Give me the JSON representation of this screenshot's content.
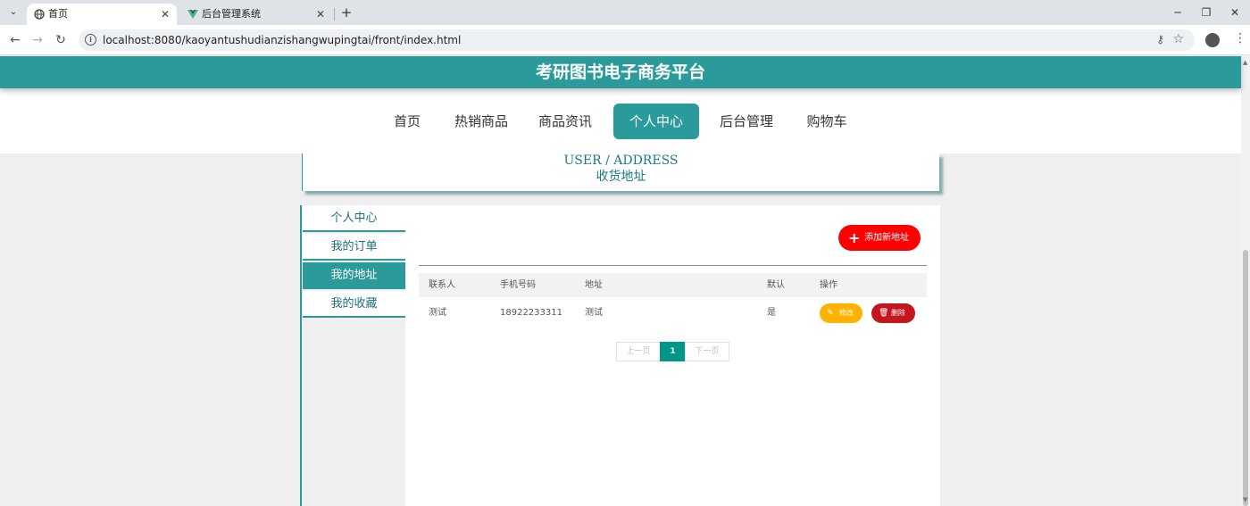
{
  "browser": {
    "tabs": [
      {
        "title": "首页",
        "active": true
      },
      {
        "title": "后台管理系统",
        "active": false
      }
    ],
    "close_glyph": "✕",
    "new_tab_glyph": "+",
    "url": "localhost:8080/kaoyantushudianzishangwupingtai/front/index.html"
  },
  "site": {
    "title": "考研图书电子商务平台",
    "nav": [
      "首页",
      "热销商品",
      "商品资讯",
      "个人中心",
      "后台管理",
      "购物车"
    ],
    "active_nav": "个人中心"
  },
  "breadcrumb": {
    "en": "USER / ADDRESS",
    "zh": "收货地址"
  },
  "sidebar": {
    "items": [
      "个人中心",
      "我的订单",
      "我的地址",
      "我的收藏"
    ],
    "active": "我的地址"
  },
  "address": {
    "add_label": "添加新地址",
    "columns": [
      "联系人",
      "手机号码",
      "地址",
      "默认",
      "操作"
    ],
    "rows": [
      {
        "contact": "测试",
        "phone": "18922233311",
        "address": "测试",
        "default": "是"
      }
    ],
    "edit_label": "修改",
    "delete_label": "删除"
  },
  "pagination": {
    "prev": "上一页",
    "current": "1",
    "next": "下一页"
  },
  "colors": {
    "accent": "#2a9b9a",
    "add": "#ff0000",
    "edit": "#ffb300",
    "delete": "#c4161c",
    "page_current": "#009688"
  },
  "icons": [
    "chevron-down-icon",
    "globe-icon",
    "vue-logo-icon",
    "close-icon",
    "plus-icon",
    "back-icon",
    "forward-icon",
    "reload-icon",
    "info-icon",
    "key-icon",
    "star-icon",
    "profile-icon",
    "more-icon",
    "pencil-icon",
    "trash-icon"
  ]
}
